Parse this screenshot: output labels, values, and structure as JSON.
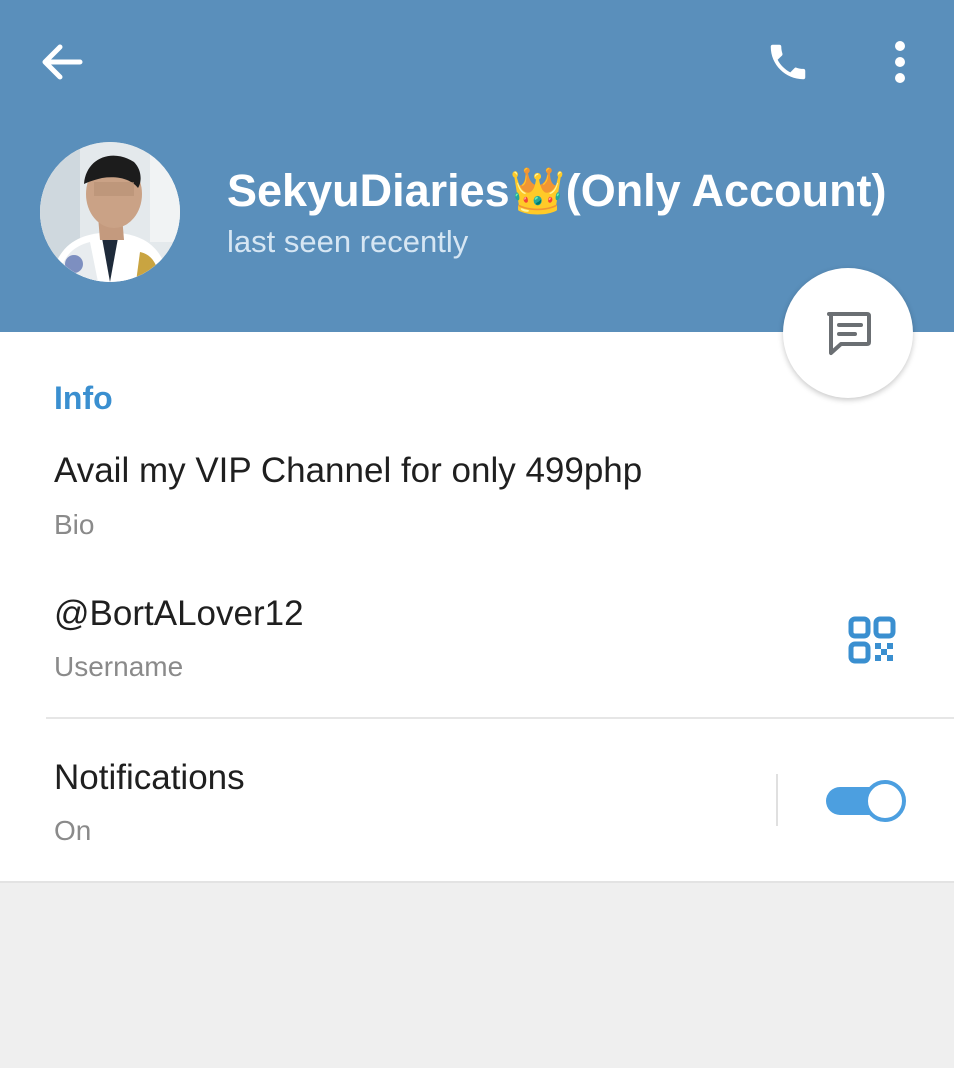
{
  "colors": {
    "header_bg": "#5a8fbb",
    "accent": "#3a8fd0",
    "toggle_on": "#4c9fe0"
  },
  "header": {
    "back_icon": "arrow-left-icon",
    "call_icon": "phone-icon",
    "more_icon": "more-vertical-icon",
    "name": "SekyuDiaries👑(Only Account)",
    "status": "last seen recently"
  },
  "fab": {
    "icon": "message-icon"
  },
  "info": {
    "section_title": "Info",
    "bio": {
      "value": "Avail my VIP Channel for only 499php",
      "label": "Bio"
    },
    "username": {
      "value": "@BortALover12",
      "label": "Username",
      "icon": "qr-code-icon"
    },
    "notifications": {
      "value": "Notifications",
      "label": "On",
      "enabled": true
    }
  }
}
